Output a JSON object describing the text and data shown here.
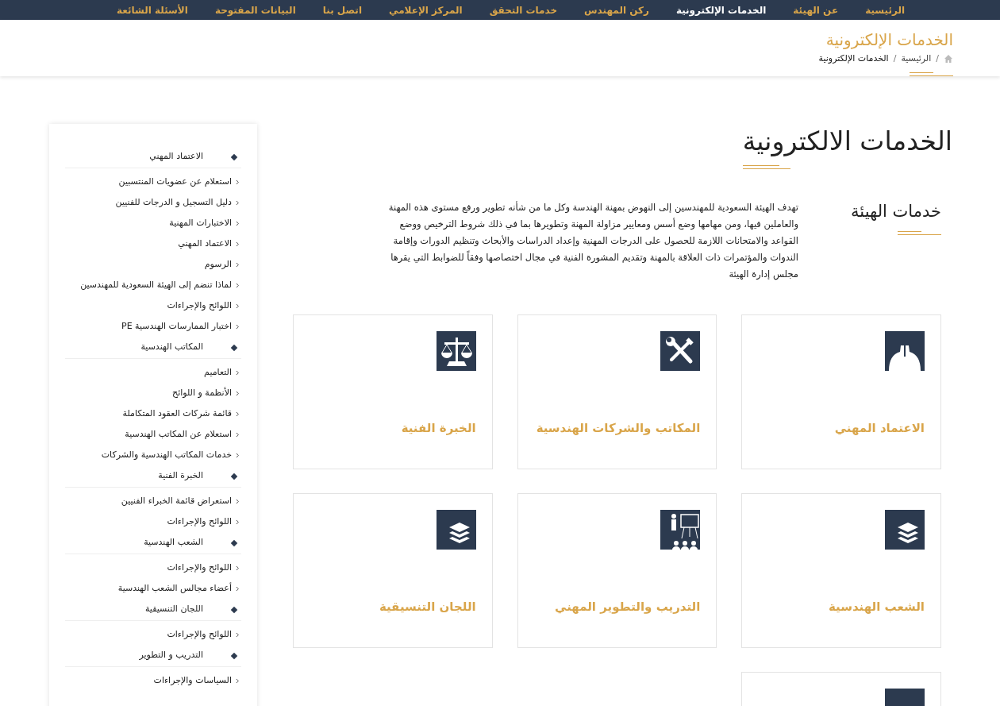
{
  "nav": [
    {
      "label": "الرئيسية",
      "selected": false
    },
    {
      "label": "عن الهيئة",
      "selected": false
    },
    {
      "label": "الخدمات الإلكترونية",
      "selected": true
    },
    {
      "label": "ركن المهندس",
      "selected": false
    },
    {
      "label": "خدمات التحقق",
      "selected": false
    },
    {
      "label": "المركز الإعلامي",
      "selected": false
    },
    {
      "label": "اتصل بنا",
      "selected": false
    },
    {
      "label": "البيانات المفتوحة",
      "selected": false
    },
    {
      "label": "الأسئلة الشائعة",
      "selected": false
    }
  ],
  "page_header": {
    "title": "الخدمات الإلكترونية",
    "breadcrumb": [
      {
        "kind": "separator",
        "text": "/"
      },
      {
        "kind": "link",
        "text": "الرئيسية"
      },
      {
        "kind": "separator",
        "text": "/"
      },
      {
        "kind": "current",
        "text": "الخدمات الإلكترونية"
      }
    ]
  },
  "heading": "الخدمات الالكترونية",
  "intro": {
    "title": "خدمات الهيئة",
    "text": "تهدف الهيئة السعودية للمهندسين إلى النهوض بمهنة الهندسة وكل ما من شأنه تطوير ورفع مستوى هذه المهنة والعاملين فيها، ومن مهامها وضع أسس ومعايير مزاولة المهنة وتطويرها بما في ذلك شروط الترخيص ووضع القواعد والامتحانات اللازمة للحصول على الدرجات المهنية وإعداد الدراسات والأبحاث وتنظيم الدورات وإقامة الندوات والمؤتمرات ذات العلاقة بالمهنة وتقديم المشورة الفنية في مجال اختصاصها وفقاً للضوابط التي يقرها مجلس إدارة الهيئة"
  },
  "cards": [
    {
      "title": "الاعتماد المهني",
      "kind": "helmet"
    },
    {
      "title": "المكاتب والشركات الهندسية",
      "kind": "tools"
    },
    {
      "title": "الخبرة الفنية",
      "kind": "scale"
    },
    {
      "title": "الشعب الهندسية",
      "kind": "layers"
    },
    {
      "title": "التدريب والتطوير المهني",
      "kind": "training"
    },
    {
      "title": "اللجان التنسيقية",
      "kind": "layers"
    },
    {
      "kind": "partial"
    }
  ],
  "sidebar": [
    {
      "title": "الاعتماد المهني",
      "children": [
        "استعلام عن عضويات المنتسبين",
        "دليل التسجيل و الدرجات للفنيين",
        "الاختبارات المهنية",
        "الاعتماد المهني",
        "الرسوم",
        "لماذا تنضم إلى الهيئة السعودية للمهندسين",
        "اللوائح والإجراءات",
        "اختبار الممارسات الهندسية PE"
      ]
    },
    {
      "title": "المكاتب الهندسية",
      "children": [
        "التعاميم",
        "الأنظمة و اللوائح",
        "قائمة شركات العقود المتكاملة",
        "استعلام عن المكاتب الهندسية",
        "خدمات المكاتب الهندسية والشركات"
      ]
    },
    {
      "title": "الخبرة الفنية",
      "children": [
        "استعراض قائمة الخبراء الفنيين",
        "اللوائح والإجراءات"
      ]
    },
    {
      "title": "الشعب الهندسية",
      "children": [
        "اللوائح والإجراءات",
        "أعضاء مجالس الشعب الهندسية"
      ]
    },
    {
      "title": "اللجان التنسيقية",
      "children": [
        "اللوائح والإجراءات"
      ]
    },
    {
      "title": "التدريب و التطوير",
      "children": [
        "السياسات والإجراءات"
      ]
    }
  ]
}
